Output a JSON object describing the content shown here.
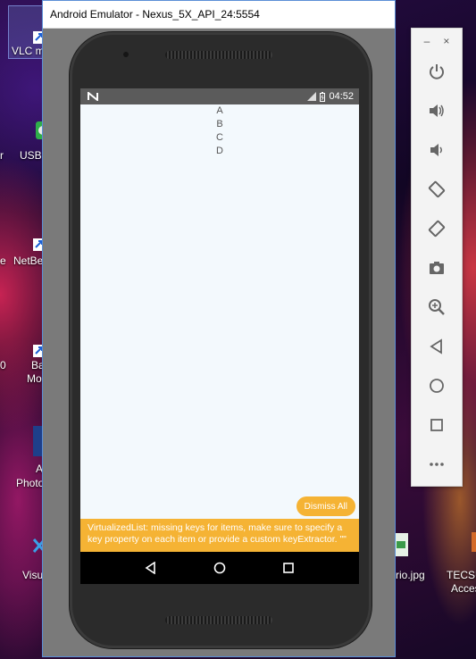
{
  "emulator": {
    "title": "Android Emulator - Nexus_5X_API_24:5554"
  },
  "status_bar": {
    "time": "04:52"
  },
  "list": {
    "items": [
      "A",
      "B",
      "C",
      "D"
    ]
  },
  "dismiss_all_label": "Dismiss All",
  "warning_text": "VirtualizedList: missing keys for items, make sure to specify a key property on each item or provide a custom keyExtractor. \"\"",
  "side_toolbar": {
    "minimize": "–",
    "close": "×"
  },
  "desktop": {
    "icons": [
      {
        "label": "VLC m"
      },
      {
        "label": "USB"
      },
      {
        "label": "NetBe"
      },
      {
        "label": "Ba"
      },
      {
        "label": "Mo"
      },
      {
        "label": "A"
      },
      {
        "label": "Photo"
      },
      {
        "label": "Visu"
      },
      {
        "label": "rio.jpg"
      },
      {
        "label": "TECSU"
      },
      {
        "label": "Acces"
      }
    ]
  },
  "colors": {
    "accent_warning": "#f5b334",
    "status_bar": "#5b5b5b",
    "screen_bg": "#f3f9fd"
  }
}
